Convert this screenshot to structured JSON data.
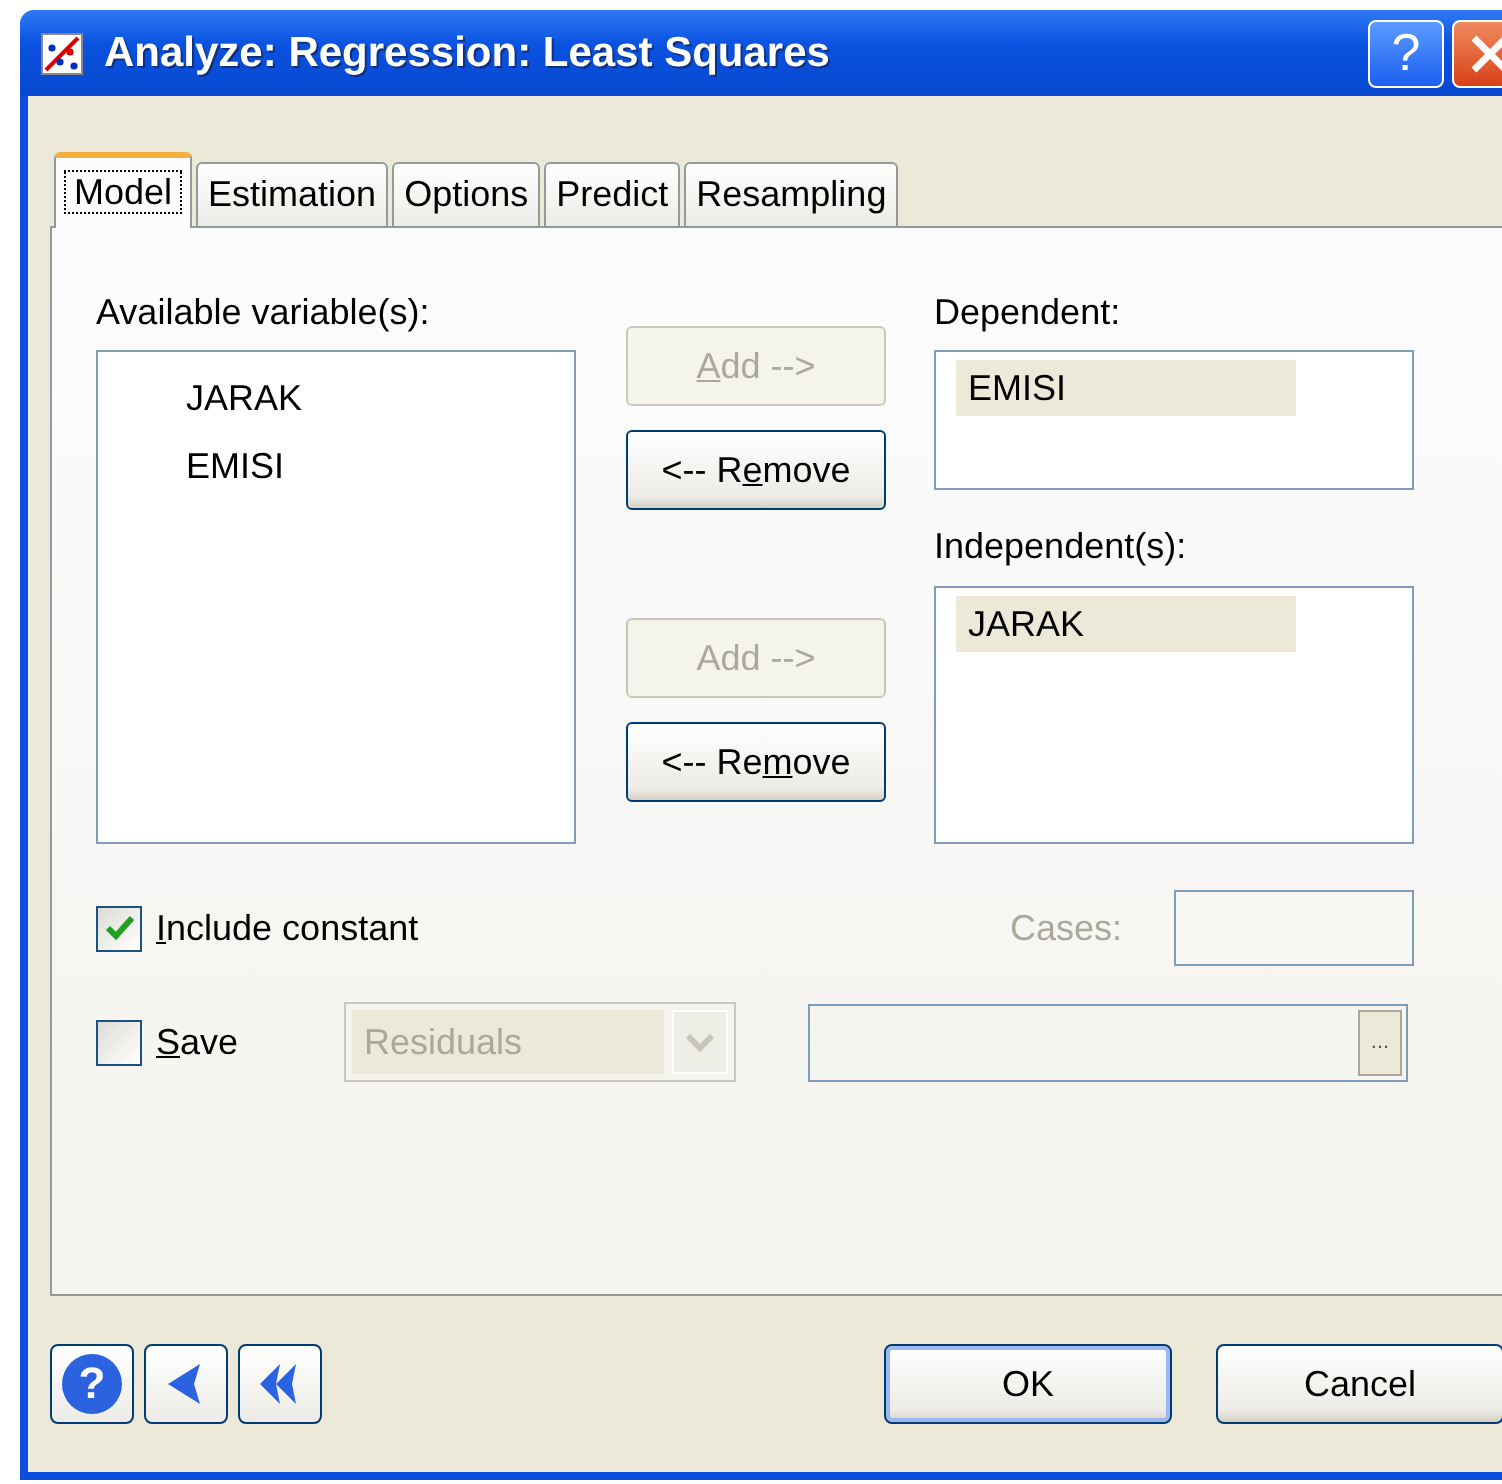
{
  "window": {
    "title": "Analyze: Regression: Least Squares",
    "help_glyph": "?"
  },
  "tabs": [
    {
      "label": "Model",
      "selected": true
    },
    {
      "label": "Estimation",
      "selected": false
    },
    {
      "label": "Options",
      "selected": false
    },
    {
      "label": "Predict",
      "selected": false
    },
    {
      "label": "Resampling",
      "selected": false
    }
  ],
  "available": {
    "label": "Available variable(s):",
    "items": [
      "JARAK",
      "EMISI"
    ]
  },
  "transfer_buttons": [
    {
      "label": {
        "key": "A",
        "after": "dd -->"
      },
      "disabled": true
    },
    {
      "label": {
        "before": "<-- R",
        "key": "e",
        "after": "move"
      },
      "disabled": false
    },
    {
      "label": {
        "before": "Add -->"
      },
      "disabled": true
    },
    {
      "label": {
        "before": "<-- Re",
        "key": "m",
        "after": "ove"
      },
      "disabled": false
    }
  ],
  "dependent": {
    "label": "Dependent:",
    "items": [
      {
        "text": "EMISI",
        "selected": true
      }
    ]
  },
  "independent": {
    "label": "Independent(s):",
    "items": [
      {
        "text": "JARAK",
        "selected": true
      }
    ]
  },
  "include_constant": {
    "label": {
      "key": "I",
      "after": "nclude constant"
    },
    "checked": true
  },
  "cases": {
    "label": "Cases:",
    "disabled": true
  },
  "save": {
    "label": {
      "key": "S",
      "after": "ave"
    },
    "checked": false,
    "combo_value": "Residuals",
    "combo_disabled": true,
    "browse_glyph": "..."
  },
  "footer": {
    "help_glyph": "?",
    "ok": "OK",
    "cancel": "Cancel"
  }
}
